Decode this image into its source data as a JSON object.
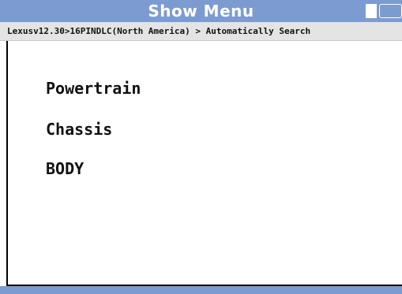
{
  "window": {
    "title": "Show Menu",
    "battery_icon": "battery-icon"
  },
  "breadcrumb": {
    "text": "Lexusv12.30>16PINDLC(North America) > Automatically Search"
  },
  "menu": {
    "items": [
      {
        "label": "Powertrain"
      },
      {
        "label": "Chassis"
      },
      {
        "label": "BODY"
      }
    ]
  },
  "colors": {
    "title_bar": "#7c9bd1",
    "breadcrumb_bar": "#e4e4e4",
    "background": "#ffffff",
    "text": "#111111"
  }
}
